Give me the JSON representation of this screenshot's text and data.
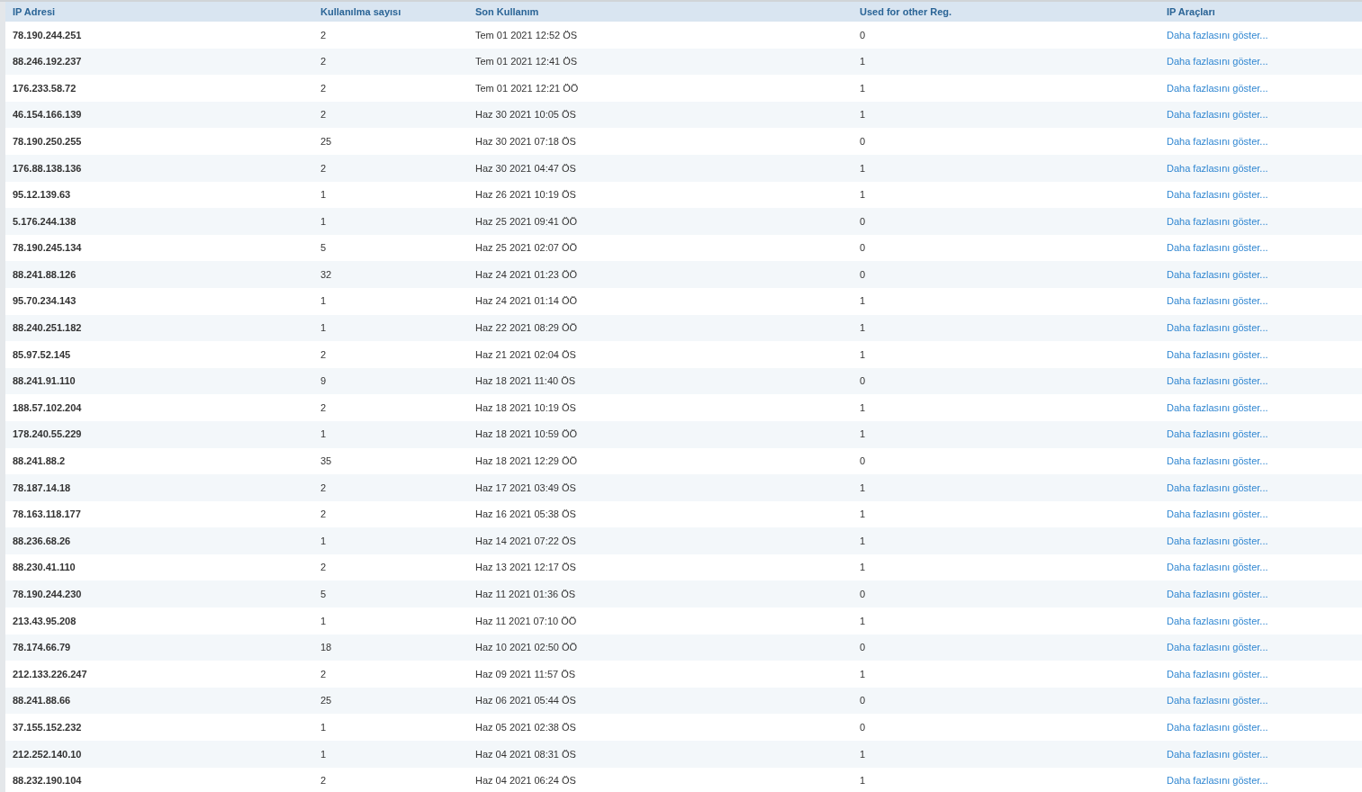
{
  "table": {
    "columns": [
      "IP Adresi",
      "Kullanılma sayısı",
      "Son Kullanım",
      "Used for other Reg.",
      "IP Araçları"
    ],
    "rows": [
      {
        "ip": "78.190.244.251",
        "count": "2",
        "last_used": "Tem 01 2021 12:52 ÖS",
        "other_reg": "0",
        "tools": "Daha fazlasını göster..."
      },
      {
        "ip": "88.246.192.237",
        "count": "2",
        "last_used": "Tem 01 2021 12:41 ÖS",
        "other_reg": "1",
        "tools": "Daha fazlasını göster..."
      },
      {
        "ip": "176.233.58.72",
        "count": "2",
        "last_used": "Tem 01 2021 12:21 ÖÖ",
        "other_reg": "1",
        "tools": "Daha fazlasını göster..."
      },
      {
        "ip": "46.154.166.139",
        "count": "2",
        "last_used": "Haz 30 2021 10:05 ÖS",
        "other_reg": "1",
        "tools": "Daha fazlasını göster..."
      },
      {
        "ip": "78.190.250.255",
        "count": "25",
        "last_used": "Haz 30 2021 07:18 ÖS",
        "other_reg": "0",
        "tools": "Daha fazlasını göster..."
      },
      {
        "ip": "176.88.138.136",
        "count": "2",
        "last_used": "Haz 30 2021 04:47 ÖS",
        "other_reg": "1",
        "tools": "Daha fazlasını göster..."
      },
      {
        "ip": "95.12.139.63",
        "count": "1",
        "last_used": "Haz 26 2021 10:19 ÖS",
        "other_reg": "1",
        "tools": "Daha fazlasını göster..."
      },
      {
        "ip": "5.176.244.138",
        "count": "1",
        "last_used": "Haz 25 2021 09:41 ÖÖ",
        "other_reg": "0",
        "tools": "Daha fazlasını göster..."
      },
      {
        "ip": "78.190.245.134",
        "count": "5",
        "last_used": "Haz 25 2021 02:07 ÖÖ",
        "other_reg": "0",
        "tools": "Daha fazlasını göster..."
      },
      {
        "ip": "88.241.88.126",
        "count": "32",
        "last_used": "Haz 24 2021 01:23 ÖÖ",
        "other_reg": "0",
        "tools": "Daha fazlasını göster..."
      },
      {
        "ip": "95.70.234.143",
        "count": "1",
        "last_used": "Haz 24 2021 01:14 ÖÖ",
        "other_reg": "1",
        "tools": "Daha fazlasını göster..."
      },
      {
        "ip": "88.240.251.182",
        "count": "1",
        "last_used": "Haz 22 2021 08:29 ÖÖ",
        "other_reg": "1",
        "tools": "Daha fazlasını göster..."
      },
      {
        "ip": "85.97.52.145",
        "count": "2",
        "last_used": "Haz 21 2021 02:04 ÖS",
        "other_reg": "1",
        "tools": "Daha fazlasını göster..."
      },
      {
        "ip": "88.241.91.110",
        "count": "9",
        "last_used": "Haz 18 2021 11:40 ÖS",
        "other_reg": "0",
        "tools": "Daha fazlasını göster..."
      },
      {
        "ip": "188.57.102.204",
        "count": "2",
        "last_used": "Haz 18 2021 10:19 ÖS",
        "other_reg": "1",
        "tools": "Daha fazlasını göster..."
      },
      {
        "ip": "178.240.55.229",
        "count": "1",
        "last_used": "Haz 18 2021 10:59 ÖÖ",
        "other_reg": "1",
        "tools": "Daha fazlasını göster..."
      },
      {
        "ip": "88.241.88.2",
        "count": "35",
        "last_used": "Haz 18 2021 12:29 ÖÖ",
        "other_reg": "0",
        "tools": "Daha fazlasını göster..."
      },
      {
        "ip": "78.187.14.18",
        "count": "2",
        "last_used": "Haz 17 2021 03:49 ÖS",
        "other_reg": "1",
        "tools": "Daha fazlasını göster..."
      },
      {
        "ip": "78.163.118.177",
        "count": "2",
        "last_used": "Haz 16 2021 05:38 ÖS",
        "other_reg": "1",
        "tools": "Daha fazlasını göster..."
      },
      {
        "ip": "88.236.68.26",
        "count": "1",
        "last_used": "Haz 14 2021 07:22 ÖS",
        "other_reg": "1",
        "tools": "Daha fazlasını göster..."
      },
      {
        "ip": "88.230.41.110",
        "count": "2",
        "last_used": "Haz 13 2021 12:17 ÖS",
        "other_reg": "1",
        "tools": "Daha fazlasını göster..."
      },
      {
        "ip": "78.190.244.230",
        "count": "5",
        "last_used": "Haz 11 2021 01:36 ÖS",
        "other_reg": "0",
        "tools": "Daha fazlasını göster..."
      },
      {
        "ip": "213.43.95.208",
        "count": "1",
        "last_used": "Haz 11 2021 07:10 ÖÖ",
        "other_reg": "1",
        "tools": "Daha fazlasını göster..."
      },
      {
        "ip": "78.174.66.79",
        "count": "18",
        "last_used": "Haz 10 2021 02:50 ÖÖ",
        "other_reg": "0",
        "tools": "Daha fazlasını göster..."
      },
      {
        "ip": "212.133.226.247",
        "count": "2",
        "last_used": "Haz 09 2021 11:57 ÖS",
        "other_reg": "1",
        "tools": "Daha fazlasını göster..."
      },
      {
        "ip": "88.241.88.66",
        "count": "25",
        "last_used": "Haz 06 2021 05:44 ÖS",
        "other_reg": "0",
        "tools": "Daha fazlasını göster..."
      },
      {
        "ip": "37.155.152.232",
        "count": "1",
        "last_used": "Haz 05 2021 02:38 ÖS",
        "other_reg": "0",
        "tools": "Daha fazlasını göster..."
      },
      {
        "ip": "212.252.140.10",
        "count": "1",
        "last_used": "Haz 04 2021 08:31 ÖS",
        "other_reg": "1",
        "tools": "Daha fazlasını göster..."
      },
      {
        "ip": "88.232.190.104",
        "count": "2",
        "last_used": "Haz 04 2021 06:24 ÖS",
        "other_reg": "1",
        "tools": "Daha fazlasını göster..."
      }
    ]
  }
}
